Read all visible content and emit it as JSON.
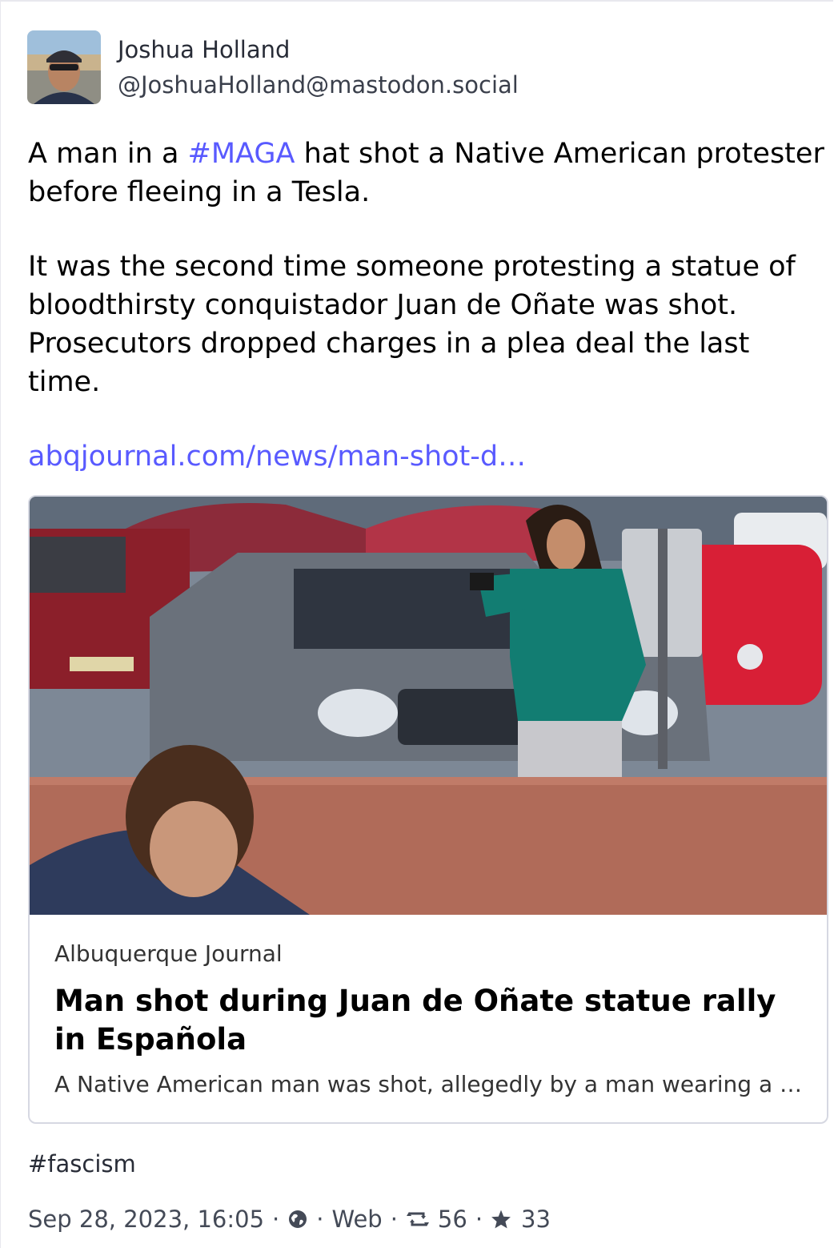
{
  "post": {
    "author": {
      "display_name": "Joshua Holland",
      "handle": "@JoshuaHolland@mastodon.social"
    },
    "body": {
      "p1_before": "A man in a ",
      "p1_hashtag": "#MAGA",
      "p1_after": " hat shot a Native American protester before fleeing in a Tesla.",
      "p2": "It was the second time someone protesting a statue of bloodthirsty conquistador Juan de Oñate was shot. Prosecutors dropped charges in a plea deal the last time.",
      "link_text": "abqjournal.com/news/man-shot-d…"
    },
    "card": {
      "provider": "Albuquerque Journal",
      "title": "Man shot during Juan de Oñate statue rally in Española",
      "description": "A Native American man was shot, allegedly by a man wearing a …"
    },
    "tags": "#fascism",
    "meta": {
      "date": "Sep 28, 2023, 16:05",
      "separator": "·",
      "visibility_icon": "globe-icon",
      "application": "Web",
      "boost_icon": "retweet-icon",
      "boosts": "56",
      "favourite_icon": "star-icon",
      "favourites": "33"
    }
  },
  "colors": {
    "link": "#595aff",
    "text": "#000000",
    "muted": "#444a57",
    "card_border": "#d6d8e2"
  }
}
